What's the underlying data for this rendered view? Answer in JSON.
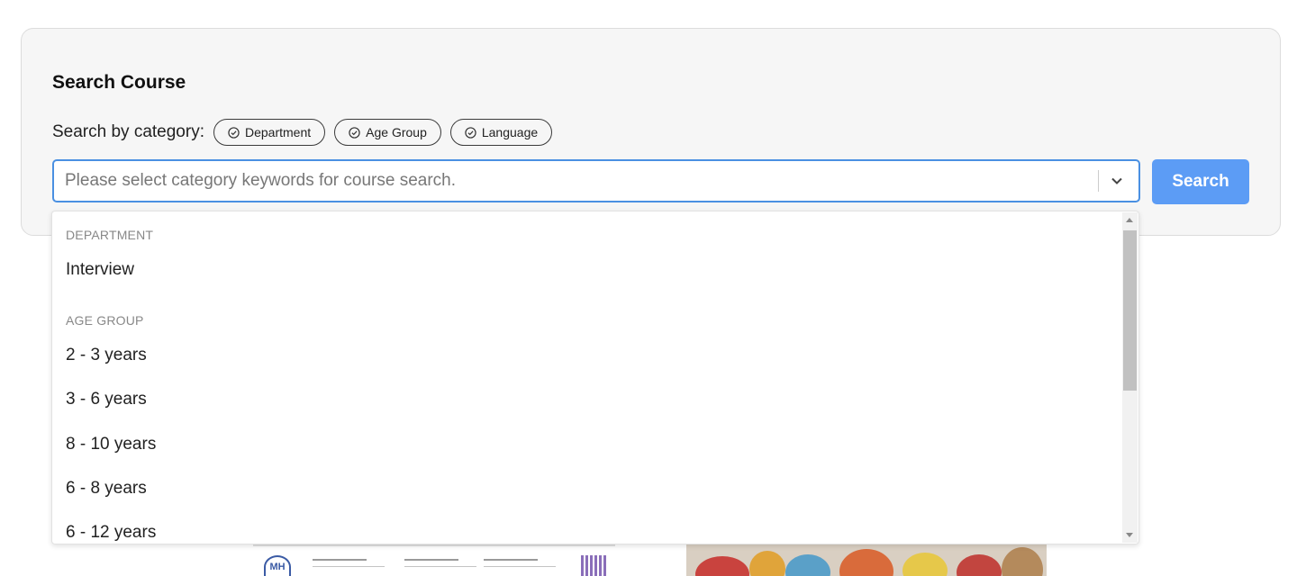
{
  "search_panel": {
    "title": "Search Course",
    "category_label": "Search by category:",
    "chips": [
      {
        "label": "Department"
      },
      {
        "label": "Age Group"
      },
      {
        "label": "Language"
      }
    ],
    "select": {
      "placeholder": "Please select category keywords for course search.",
      "value": ""
    },
    "search_button_label": "Search"
  },
  "dropdown": {
    "groups": [
      {
        "heading": "Department",
        "options": [
          "Interview"
        ]
      },
      {
        "heading": "Age Group",
        "options": [
          "2 - 3 years",
          "3 - 6 years",
          "8 - 10 years",
          "6 - 8 years",
          "6 - 12 years"
        ]
      }
    ]
  },
  "colors": {
    "accent": "#4a90e2",
    "button": "#5c9cf5",
    "panel_bg": "#f6f6f6"
  },
  "icons": {
    "chip": "check-circle-icon",
    "select_toggle": "chevron-down-icon"
  }
}
